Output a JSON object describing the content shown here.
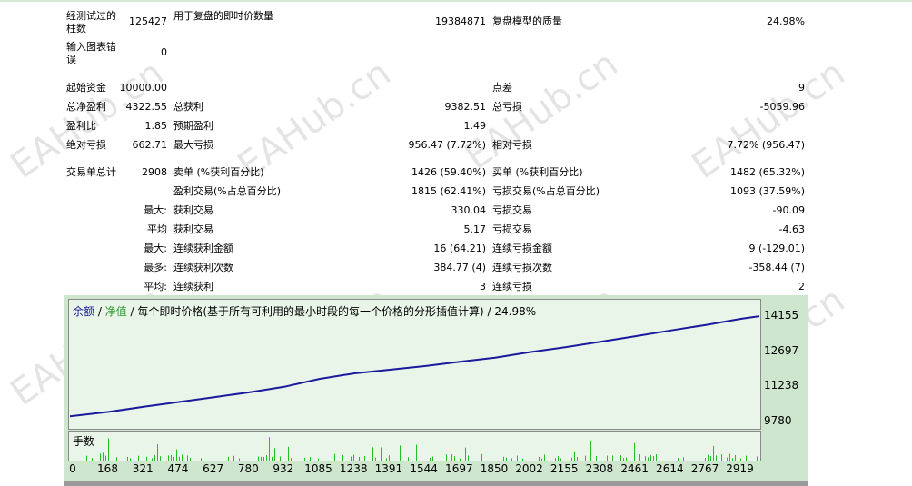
{
  "report": {
    "rows": [
      {
        "label": "经测试过的柱数",
        "value": "125427",
        "col2_label": "用于复盘的即时价数量",
        "col2_value": "19384871",
        "col3_label": "复盘模型的质量",
        "col3_value": "24.98%"
      },
      {
        "label": "输入图表错误",
        "value": "0"
      },
      {
        "label": "起始资金",
        "value": "10000.00",
        "col3_label": "点差",
        "col3_value": "9"
      },
      {
        "label": "总净盈利",
        "value": "4322.55",
        "col2_label": "总获利",
        "col2_value": "9382.51",
        "col3_label": "总亏损",
        "col3_value": "-5059.96"
      },
      {
        "label": "盈利比",
        "value": "1.85",
        "col2_label": "预期盈利",
        "col2_value": "1.49"
      },
      {
        "label": "绝对亏损",
        "value": "662.71",
        "col2_label": "最大亏损",
        "col2_value": "956.47 (7.72%)",
        "col3_label": "相对亏损",
        "col3_value": "7.72% (956.47)"
      },
      {
        "label": "交易单总计",
        "value": "2908",
        "col2_label": "卖单 (%获利百分比)",
        "col2_value": "1426 (59.40%)",
        "col3_label": "买单 (%获利百分比)",
        "col3_value": "1482 (65.32%)"
      },
      {
        "col2_label": "盈利交易(%占总百分比)",
        "col2_value": "1815 (62.41%)",
        "col3_label": "亏损交易(%占总百分比)",
        "col3_value": "1093 (37.59%)"
      },
      {
        "value": "最大:",
        "col2_label": "获利交易",
        "col2_value": "330.04",
        "col3_label": "亏损交易",
        "col3_value": "-90.09"
      },
      {
        "value": "平均",
        "col2_label": "获利交易",
        "col2_value": "5.17",
        "col3_label": "亏损交易",
        "col3_value": "-4.63"
      },
      {
        "value": "最大:",
        "col2_label": "连续获利金额",
        "col2_value": "16 (64.21)",
        "col3_label": "连续亏损金额",
        "col3_value": "9 (-129.01)"
      },
      {
        "value": "最多:",
        "col2_label": "连续获利次数",
        "col2_value": "384.77 (4)",
        "col3_label": "连续亏损次数",
        "col3_value": "-358.44 (7)"
      },
      {
        "value": "平均:",
        "col2_label": "连续获利",
        "col2_value": "3",
        "col3_label": "连续亏损",
        "col3_value": "2"
      }
    ]
  },
  "watermark": "EAHub.cn",
  "chart_legend": {
    "balance": "余额",
    "sep": " / ",
    "equity": "净值",
    "desc": " / 每个即时价格(基于所有可利用的最小时段的每一个价格的分形插值计算) / 24.98%"
  },
  "volume_label": "手数",
  "colors": {
    "balance": "#1a1a9c",
    "volume": "#23c023",
    "panel": "#cde6cd"
  },
  "chart_data": {
    "type": "line",
    "x_ticks": [
      0,
      168,
      321,
      474,
      627,
      780,
      932,
      1085,
      1238,
      1391,
      1544,
      1697,
      1850,
      2002,
      2155,
      2308,
      2461,
      2614,
      2767,
      2919
    ],
    "y_ticks": [
      14155,
      12697,
      11238,
      9780
    ],
    "ylim": [
      9780,
      14155
    ],
    "xlim": [
      0,
      3000
    ],
    "series": [
      {
        "name": "余额",
        "x": [
          0,
          168,
          321,
          474,
          627,
          780,
          932,
          1085,
          1238,
          1391,
          1544,
          1697,
          1850,
          2002,
          2155,
          2308,
          2461,
          2614,
          2767,
          2919,
          3000
        ],
        "y": [
          10000,
          10180,
          10390,
          10590,
          10790,
          10990,
          11220,
          11550,
          11780,
          11930,
          12080,
          12260,
          12430,
          12660,
          12860,
          13090,
          13320,
          13560,
          13790,
          14040,
          14150
        ]
      }
    ]
  }
}
